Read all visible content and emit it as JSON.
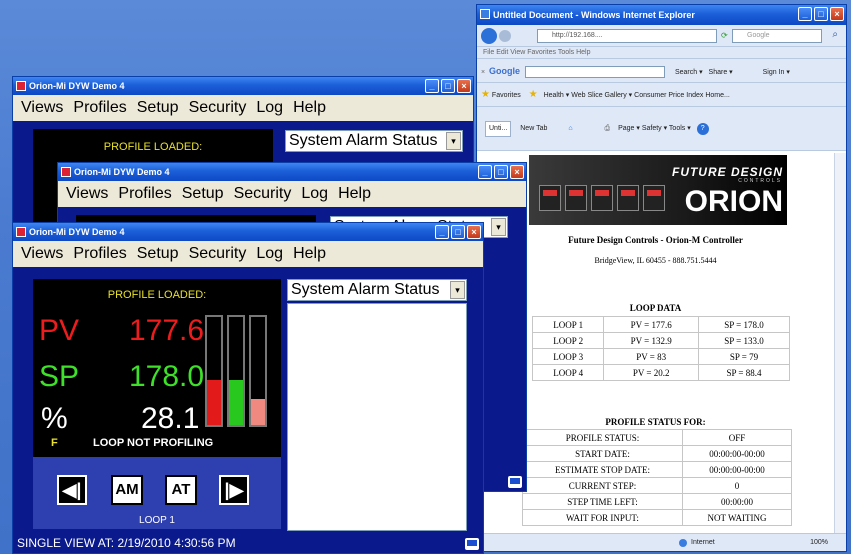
{
  "orion_windows": [
    {
      "title": "Orion-Mi DYW Demo 4"
    },
    {
      "title": "Orion-Mi DYW Demo 4"
    },
    {
      "title": "Orion-Mi DYW Demo 4"
    }
  ],
  "menu": [
    "Views",
    "Profiles",
    "Setup",
    "Security",
    "Log",
    "Help"
  ],
  "alarm_dropdown": "System Alarm Status",
  "partial_dropdown": "System Alarm Status",
  "loop_panel": {
    "profile_loaded": "PROFILE LOADED:",
    "pv_label": "PV",
    "pv_value": "177.6",
    "sp_label": "SP",
    "sp_value": "178.0",
    "pct_label": "%",
    "pct_value": "28.1",
    "f_label": "F",
    "loop_status": "LOOP NOT PROFILING",
    "loop_name": "LOOP 1",
    "bars": {
      "pv_level": 0.42,
      "sp_level": 0.42,
      "out_level": 0.24
    }
  },
  "back_panel": {
    "profile_loaded": "PROFILE LOADED:"
  },
  "buttons": {
    "prev": "◀|",
    "am": "AM",
    "at": "AT",
    "next": "|▶"
  },
  "status_bar": "SINGLE VIEW AT:  2/19/2010 4:30:56 PM",
  "ie": {
    "title": "Untitled Document - Windows Internet Explorer",
    "address": "http://192.168....",
    "search_placeholder": "Google",
    "menu": "File   Edit   View   Favorites   Tools   Help",
    "google_label": "Google",
    "favorites": "Favorites",
    "fav_items": "Health ▾   Web Slice Gallery ▾   Consumer Price Index Home...",
    "tab1": "Unti...",
    "tab2": "New Tab",
    "tools": "Page ▾  Safety ▾  Tools ▾",
    "search_btn": "Search ▾",
    "share_btn": "Share ▾",
    "signin": "Sign In ▾",
    "status": "Internet",
    "zoom": "100%",
    "brand_top": "FUTURE DESIGN",
    "brand_ctrls": "CONTROLS",
    "brand_main": "ORION",
    "company": "Future Design Controls - Orion-M Controller",
    "address_line": "BridgeView, IL 60455 - 888.751.5444",
    "loop_data_title": "LOOP DATA",
    "loop_data": [
      {
        "loop": "LOOP 1",
        "pv": "PV = 177.6",
        "sp": "SP = 178.0"
      },
      {
        "loop": "LOOP 2",
        "pv": "PV = 132.9",
        "sp": "SP = 133.0"
      },
      {
        "loop": "LOOP 3",
        "pv": "PV = 83",
        "sp": "SP = 79"
      },
      {
        "loop": "LOOP 4",
        "pv": "PV = 20.2",
        "sp": "SP = 88.4"
      }
    ],
    "profile_title": "PROFILE STATUS FOR:",
    "profile_status": [
      {
        "label": "PROFILE STATUS:",
        "value": "OFF"
      },
      {
        "label": "START DATE:",
        "value": "00:00:00-00:00"
      },
      {
        "label": "ESTIMATE STOP DATE:",
        "value": "00:00:00-00:00"
      },
      {
        "label": "CURRENT STEP:",
        "value": "0"
      },
      {
        "label": "STEP TIME LEFT:",
        "value": "00:00:00"
      },
      {
        "label": "WAIT FOR INPUT:",
        "value": "NOT WAITING"
      }
    ]
  },
  "colors": {
    "window_bg": "#0a1a8c",
    "pv": "#ee1c1c",
    "sp": "#3ee02a",
    "desktop": "#4a7bd0"
  }
}
